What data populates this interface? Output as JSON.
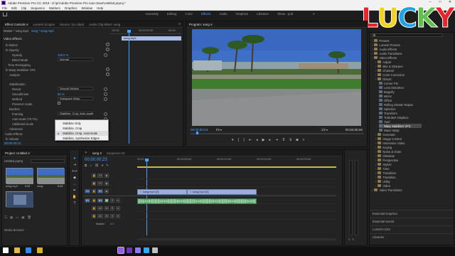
{
  "window": {
    "title": "Adobe Premiere Pro CC 2018 - D:\\pr\\Adobe Premiere Pro Auto-Save\\Untitled.prproj *",
    "menu": [
      "File",
      "Edit",
      "Clip",
      "Sequence",
      "Markers",
      "Graphics",
      "Window",
      "Help"
    ],
    "workspaces": [
      "Assembly",
      "Editing",
      "Color",
      "Effects",
      "Audio",
      "Graphics",
      "Libraries",
      "Show - pull"
    ],
    "active_workspace": "Effects",
    "logo_text": "LUCKY"
  },
  "effect_controls": {
    "tabs": [
      "Effect Controls ≡",
      "Lumetri Scopes",
      "Source: (no clips)",
      "Audio Clip Mixer: song"
    ],
    "breadcrumb": [
      "Master * song.mp4",
      "song * song.mp4"
    ],
    "ruler": [
      ":00:00",
      "00:00:05:00",
      "00:00:"
    ],
    "clip_bar_label": "song.mp4",
    "section_header": "Video Effects",
    "rows": [
      {
        "label": "fx  Motion",
        "value": ""
      },
      {
        "label": "fx  Opacity",
        "value": ""
      },
      {
        "label": "Opacity",
        "value": "100.0 %"
      },
      {
        "label": "Blend Mode",
        "value": "Normal"
      },
      {
        "label": "Time Remapping",
        "value": ""
      },
      {
        "label": "fx  Warp Stabilizer VFX",
        "value": ""
      },
      {
        "label": "Analyze",
        "value": ""
      },
      {
        "label": "Stabilization",
        "value": ""
      },
      {
        "label": "Result",
        "value": "Smooth Motion"
      },
      {
        "label": "Smoothness",
        "value": "50 %"
      },
      {
        "label": "Method",
        "value": "Subspace Warp"
      },
      {
        "label": "Preserve Scale",
        "value": ""
      },
      {
        "label": "Borders",
        "value": ""
      },
      {
        "label": "Framing",
        "value": "Stabilize, Crop, Auto-scale"
      },
      {
        "label": "Auto-scale (70.7%)",
        "value": ""
      },
      {
        "label": "Additional Scale",
        "value": ""
      },
      {
        "label": "Advanced",
        "value": ""
      },
      {
        "label": "Audio Effects",
        "value": ""
      },
      {
        "label": "fx  Volume",
        "value": ""
      }
    ],
    "framing_dropdown_options": [
      "Stabilize Only",
      "Stabilize, Crop",
      "Stabilize, Crop, Auto-scale",
      "Stabilize, Synthesize Edges"
    ],
    "framing_selected": "Stabilize, Crop, Auto-scale",
    "timecode": "00:00:00:23"
  },
  "program_monitor": {
    "tab": "Program: song ≡",
    "timecode_left": "00;00;00;23",
    "fit": "Fit",
    "quality": "1/2",
    "timecode_right": "00;00;06;06"
  },
  "effects_panel": {
    "items": [
      {
        "label": "Presets",
        "kind": "folder",
        "indent": 0
      },
      {
        "label": "Lumetri Presets",
        "kind": "folder",
        "indent": 0
      },
      {
        "label": "Audio Effects",
        "kind": "folder",
        "indent": 0
      },
      {
        "label": "Audio Transitions",
        "kind": "folder",
        "indent": 0
      },
      {
        "label": "Video Effects",
        "kind": "folder",
        "indent": 0
      },
      {
        "label": "Adjust",
        "kind": "folder",
        "indent": 1
      },
      {
        "label": "Blur & Sharpen",
        "kind": "folder",
        "indent": 1
      },
      {
        "label": "Channel",
        "kind": "folder",
        "indent": 1
      },
      {
        "label": "Color Correction",
        "kind": "folder",
        "indent": 1
      },
      {
        "label": "Distort",
        "kind": "folder",
        "indent": 1
      },
      {
        "label": "Corner Pin",
        "kind": "fx",
        "indent": 2
      },
      {
        "label": "Lens Distortion",
        "kind": "fx",
        "indent": 2
      },
      {
        "label": "Magnify",
        "kind": "fx",
        "indent": 2
      },
      {
        "label": "Mirror",
        "kind": "fx",
        "indent": 2
      },
      {
        "label": "Offset",
        "kind": "fx",
        "indent": 2
      },
      {
        "label": "Rolling Shutter Repair",
        "kind": "fx",
        "indent": 2
      },
      {
        "label": "Spherize",
        "kind": "fx",
        "indent": 2
      },
      {
        "label": "Transform",
        "kind": "fx",
        "indent": 2
      },
      {
        "label": "Turbulent Displace",
        "kind": "fx",
        "indent": 2
      },
      {
        "label": "Twirl",
        "kind": "fx",
        "indent": 2
      },
      {
        "label": "Warp Stabilizer VFX",
        "kind": "fx",
        "indent": 2
      },
      {
        "label": "Wave Warp",
        "kind": "fx",
        "indent": 2
      },
      {
        "label": "Generate",
        "kind": "folder",
        "indent": 1
      },
      {
        "label": "Image Control",
        "kind": "folder",
        "indent": 1
      },
      {
        "label": "Immersive Video",
        "kind": "folder",
        "indent": 1
      },
      {
        "label": "Keying",
        "kind": "folder",
        "indent": 1
      },
      {
        "label": "Noise & Grain",
        "kind": "folder",
        "indent": 1
      },
      {
        "label": "Obsolete",
        "kind": "folder",
        "indent": 1
      },
      {
        "label": "Perspective",
        "kind": "folder",
        "indent": 1
      },
      {
        "label": "Stylize",
        "kind": "folder",
        "indent": 1
      },
      {
        "label": "Time",
        "kind": "folder",
        "indent": 1
      },
      {
        "label": "Transform",
        "kind": "folder",
        "indent": 1
      },
      {
        "label": "Transition",
        "kind": "folder",
        "indent": 1
      },
      {
        "label": "Utility",
        "kind": "folder",
        "indent": 1
      },
      {
        "label": "Video",
        "kind": "folder",
        "indent": 1
      },
      {
        "label": "Video Transitions",
        "kind": "folder",
        "indent": 0
      }
    ],
    "selected": "Warp Stabilizer VFX",
    "bottom_sections": [
      "Essential Graphics",
      "Essential Sound",
      "Lumetri Color",
      "Libraries"
    ]
  },
  "project": {
    "tab": "Project: Untitled ≡",
    "file": "Untitled.prproj",
    "items": [
      {
        "name": "song.mp4",
        "duration": "6:06"
      },
      {
        "name": "song",
        "duration": "6:06"
      }
    ],
    "media_browser": "Media Browser"
  },
  "timeline": {
    "tabs": [
      "song ≡",
      "Sequence 01"
    ],
    "timecode": "00;00;00;23",
    "ruler": [
      "00:00",
      "00:00:05:00",
      "00:00:10:00",
      "00:00:15:00",
      "00:00:20:00"
    ],
    "tracks": [
      "V3",
      "V2",
      "V1",
      "A1",
      "A2",
      "A3"
    ],
    "track_targets": [
      "V1",
      "A1"
    ],
    "master": "Master",
    "master_value": "0.0",
    "video_clips": [
      {
        "label": "song.mp4 [V]",
        "start": 0.0,
        "end": 5.0
      },
      {
        "label": "song.mp4 [V]",
        "start": 5.0,
        "end": 12.0
      }
    ],
    "audio_clips": [
      {
        "start": 0.0,
        "end": 12.0
      }
    ],
    "playhead_seconds": 0.96,
    "visible_seconds": 20
  },
  "tools": [
    "selection",
    "track-select",
    "ripple",
    "razor",
    "slip",
    "pen",
    "hand",
    "type"
  ],
  "taskbar": {
    "icons": [
      "start",
      "file-explorer",
      "edge",
      "chrome",
      "premiere",
      "media-encoder",
      "after-effects",
      "photoshop",
      "other"
    ]
  },
  "colors": {
    "accent": "#2d8ceb",
    "timecode": "#2d8ceb",
    "video_clip": "#9aaedc",
    "audio_clip": "#5fa46b",
    "logo": [
      "#e8252b",
      "#f3d21c",
      "#21a2e3",
      "#5ec24b",
      "#e8252b"
    ]
  }
}
